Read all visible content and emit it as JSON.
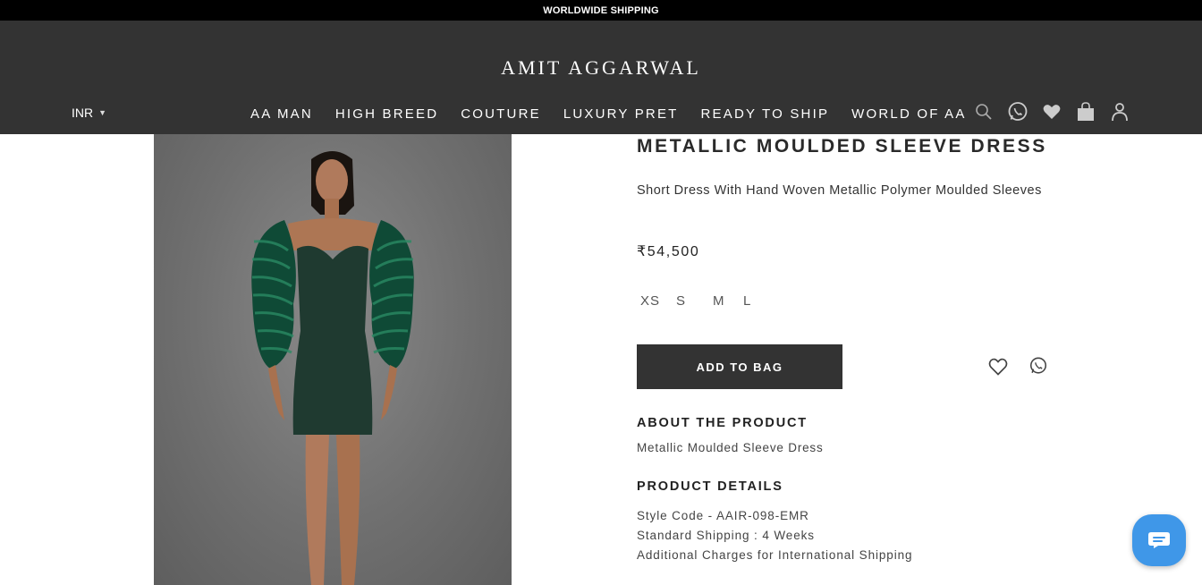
{
  "promo": {
    "text": "WORLDWIDE SHIPPING"
  },
  "header": {
    "logo": "AMIT AGGARWAL",
    "currency": "INR",
    "nav": [
      "AA MAN",
      "HIGH BREED",
      "COUTURE",
      "LUXURY PRET",
      "READY TO SHIP",
      "WORLD OF AA"
    ],
    "icons": [
      "search-icon",
      "whatsapp-icon",
      "heart-icon",
      "shopping-bag-icon",
      "user-icon"
    ]
  },
  "product": {
    "title": "METALLIC MOULDED SLEEVE DRESS",
    "subtitle": "Short Dress With Hand Woven Metallic Polymer Moulded Sleeves",
    "price": "₹54,500",
    "sizes": [
      "XS",
      "S",
      "M",
      "L"
    ],
    "add_to_bag": "ADD TO BAG",
    "about_heading": "ABOUT THE PRODUCT",
    "about_text": "Metallic Moulded Sleeve Dress",
    "details_heading": "PRODUCT DETAILS",
    "details": [
      "Style Code - AAIR-098-EMR",
      "Standard Shipping : 4 Weeks",
      "Additional Charges for International Shipping"
    ]
  },
  "colors": {
    "header_bg": "#333333",
    "promo_bg": "#000000",
    "button_bg": "#333333",
    "chat_bubble": "#3f97e8",
    "dress_green": "#1f3a30"
  }
}
